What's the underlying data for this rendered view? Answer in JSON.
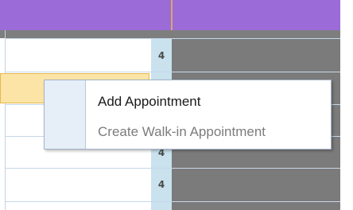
{
  "calendar": {
    "colors": {
      "header": "#9b6bd8",
      "subheader": "#7e7e7e",
      "busy_column": "#7b7b7b",
      "number_column": "#c9e2ee",
      "selected_slot": "#fbe4a6"
    },
    "rows": [
      {
        "count": "4"
      },
      {
        "count": ""
      },
      {
        "count": ""
      },
      {
        "count": "4"
      },
      {
        "count": "4"
      }
    ]
  },
  "context_menu": {
    "items": [
      {
        "label": "Add Appointment",
        "enabled": true
      },
      {
        "label": "Create Walk-in Appointment",
        "enabled": false
      }
    ]
  }
}
